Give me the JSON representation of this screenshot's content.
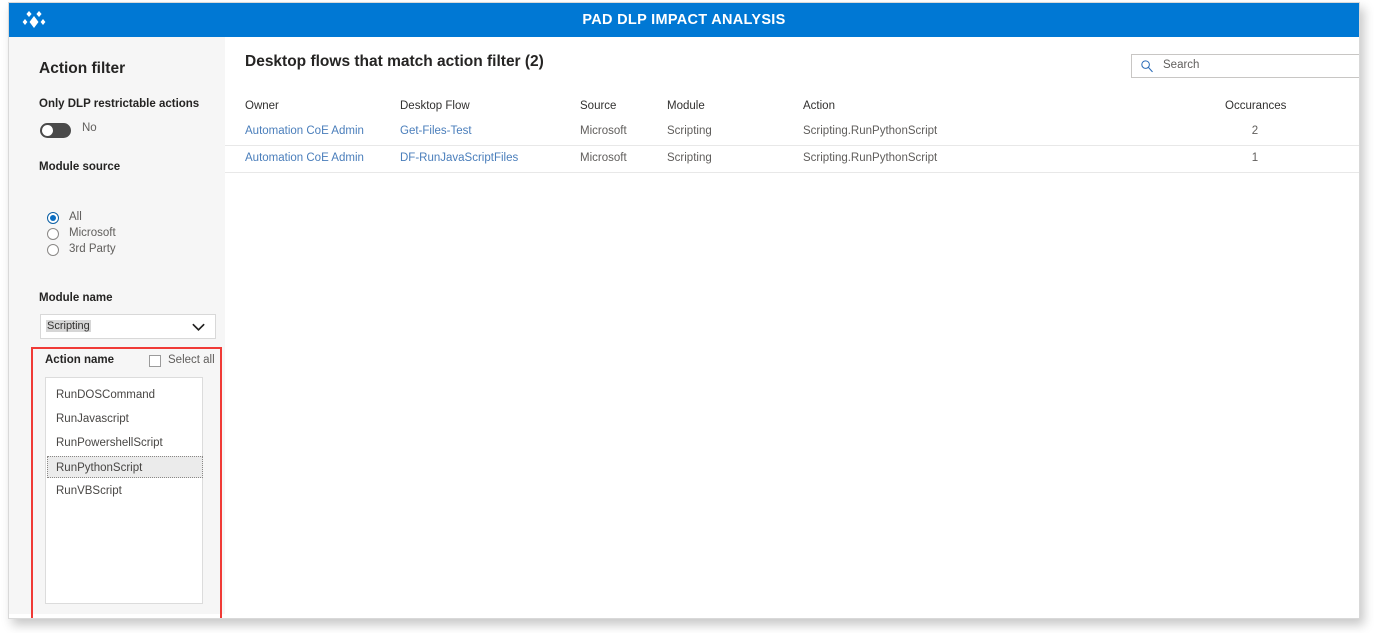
{
  "header": {
    "title": "PAD DLP IMPACT ANALYSIS",
    "logo_icon": "power-platform-diamond-logo",
    "background_color": "#0078d4"
  },
  "sidebar": {
    "heading": "Action filter",
    "only_dlp": {
      "label": "Only DLP restrictable actions",
      "toggle_value": "No",
      "toggle_on": false
    },
    "module_source": {
      "label": "Module source",
      "options": [
        {
          "label": "All",
          "selected": true
        },
        {
          "label": "Microsoft",
          "selected": false
        },
        {
          "label": "3rd Party",
          "selected": false
        }
      ]
    },
    "module_name": {
      "label": "Module name",
      "value": "Scripting",
      "chevron_icon": "chevron-down-icon"
    },
    "action_name": {
      "label": "Action name",
      "select_all_label": "Select all",
      "select_all_checked": false,
      "items": [
        {
          "label": "RunDOSCommand",
          "selected": false
        },
        {
          "label": "RunJavascript",
          "selected": false
        },
        {
          "label": "RunPowershellScript",
          "selected": false
        },
        {
          "label": "RunPythonScript",
          "selected": true
        },
        {
          "label": "RunVBScript",
          "selected": false
        }
      ]
    },
    "annotation_color": "#f03a36"
  },
  "main": {
    "title": "Desktop flows that match action filter (2)",
    "search": {
      "placeholder": "Search",
      "value": "",
      "icon": "search-icon"
    },
    "table": {
      "columns": [
        "Owner",
        "Desktop Flow",
        "Source",
        "Module",
        "Action",
        "Occurances"
      ],
      "rows": [
        {
          "owner": "Automation CoE Admin",
          "desktop_flow": "Get-Files-Test",
          "source": "Microsoft",
          "module": "Scripting",
          "action": "Scripting.RunPythonScript",
          "occurances": "2"
        },
        {
          "owner": "Automation CoE Admin",
          "desktop_flow": "DF-RunJavaScriptFiles",
          "source": "Microsoft",
          "module": "Scripting",
          "action": "Scripting.RunPythonScript",
          "occurances": "1"
        }
      ]
    }
  }
}
